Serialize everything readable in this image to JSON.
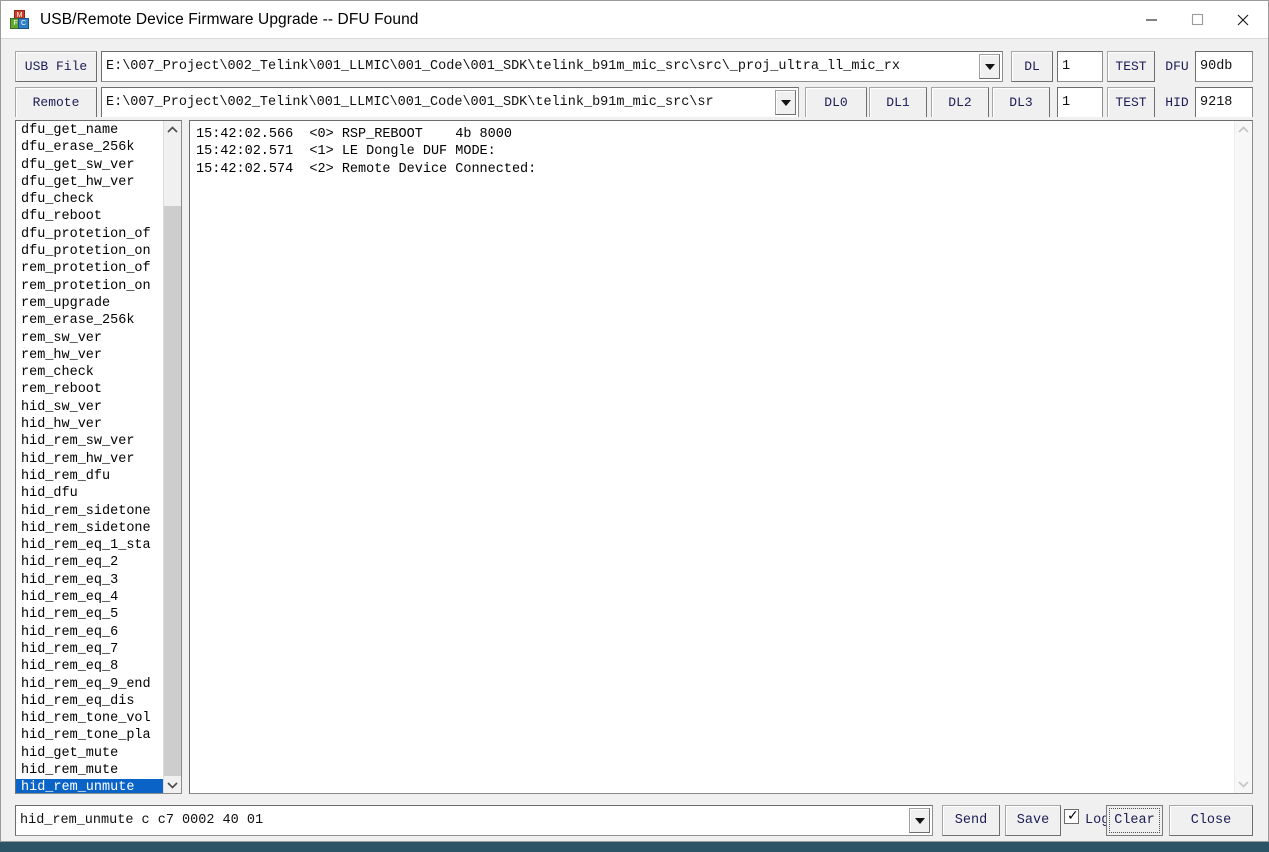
{
  "window": {
    "title": "USB/Remote Device Firmware Upgrade -- DFU Found",
    "minimize": "—",
    "maximize": "□",
    "close": "✕",
    "icon": "app-blocks-icon"
  },
  "toolbar": {
    "usb_file_label": "USB File",
    "usb_file_value": "E:\\007_Project\\002_Telink\\001_LLMIC\\001_Code\\001_SDK\\telink_b91m_mic_src\\src\\_proj_ultra_ll_mic_rx",
    "remote_label": "Remote",
    "remote_value": "E:\\007_Project\\002_Telink\\001_LLMIC\\001_Code\\001_SDK\\telink_b91m_mic_src\\sr",
    "dl_button": "DL",
    "dl0_button": "DL0",
    "dl1_button": "DL1",
    "dl2_button": "DL2",
    "dl3_button": "DL3",
    "dfu_count_value": "1",
    "hid_count_value": "1",
    "test_dfu_button": "TEST",
    "test_hid_button": "TEST",
    "dfu_label": "DFU",
    "dfu_value": "90db",
    "hid_label": "HID",
    "hid_value": "9218"
  },
  "command_list": {
    "selected": "hid_rem_unmute",
    "items": [
      "dfu_get_name",
      "dfu_erase_256k",
      "dfu_get_sw_ver",
      "dfu_get_hw_ver",
      "dfu_check",
      "dfu_reboot",
      "dfu_protetion_of",
      "dfu_protetion_on",
      "rem_protetion_of",
      "rem_protetion_on",
      "rem_upgrade",
      "rem_erase_256k",
      "rem_sw_ver",
      "rem_hw_ver",
      "rem_check",
      "rem_reboot",
      "hid_sw_ver",
      "hid_hw_ver",
      "hid_rem_sw_ver",
      "hid_rem_hw_ver",
      "hid_rem_dfu",
      "hid_dfu",
      "hid_rem_sidetone",
      "hid_rem_sidetone",
      "hid_rem_eq_1_sta",
      "hid_rem_eq_2",
      "hid_rem_eq_3",
      "hid_rem_eq_4",
      "hid_rem_eq_5",
      "hid_rem_eq_6",
      "hid_rem_eq_7",
      "hid_rem_eq_8",
      "hid_rem_eq_9_end",
      "hid_rem_eq_dis",
      "hid_rem_tone_vol",
      "hid_rem_tone_pla",
      "hid_get_mute",
      "hid_rem_mute",
      "hid_rem_unmute"
    ]
  },
  "log": {
    "lines": [
      "15:42:02.566  <0> RSP_REBOOT    4b 8000",
      "15:42:02.571  <1> LE Dongle DUF MODE:",
      "15:42:02.574  <2> Remote Device Connected:"
    ]
  },
  "bottom": {
    "command_value": "hid_rem_unmute c c7 0002 40 01",
    "send_button": "Send",
    "save_button": "Save",
    "log_checkbox_label": "Log",
    "log_checkbox_checked": true,
    "clear_button": "Clear",
    "close_button": "Close"
  },
  "colors": {
    "selection_blue": "#0a64c8",
    "button_face": "#f0f0f0",
    "button_text": "#1c1c55",
    "window_bg": "#f0f0f0"
  }
}
